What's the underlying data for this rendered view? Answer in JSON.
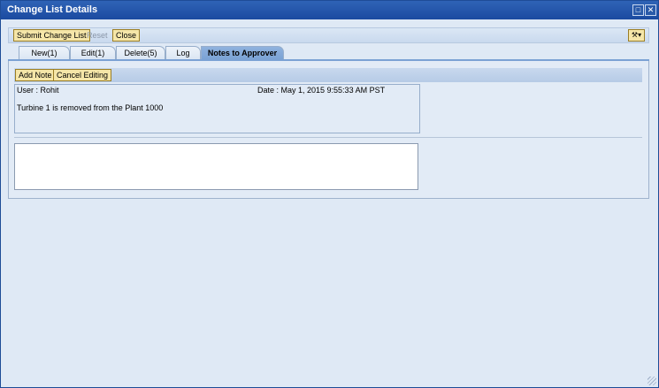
{
  "window": {
    "title": "Change List Details",
    "maximize_icon": "maximize-icon",
    "close_icon": "close-icon"
  },
  "toolbar": {
    "submit_label": "Submit Change List",
    "reset_label": "Reset",
    "close_label": "Close",
    "personalize_icon": "wrench-icon"
  },
  "tabs": [
    {
      "label": "New(1)"
    },
    {
      "label": "Edit(1)"
    },
    {
      "label": "Delete(5)"
    },
    {
      "label": "Log"
    },
    {
      "label": "Notes to Approver"
    }
  ],
  "notes": {
    "add_note_label": "Add Note",
    "cancel_editing_label": "Cancel Editing",
    "entry": {
      "user": "User : Rohit",
      "date": "Date : May 1, 2015 9:55:33 AM PST",
      "text": "Turbine 1 is removed from the Plant 1000"
    },
    "new_note_value": ""
  },
  "colors": {
    "title_bar": "#1b4aa0",
    "active_tab": "#7ba2d4",
    "button": "#f5e6a8"
  }
}
